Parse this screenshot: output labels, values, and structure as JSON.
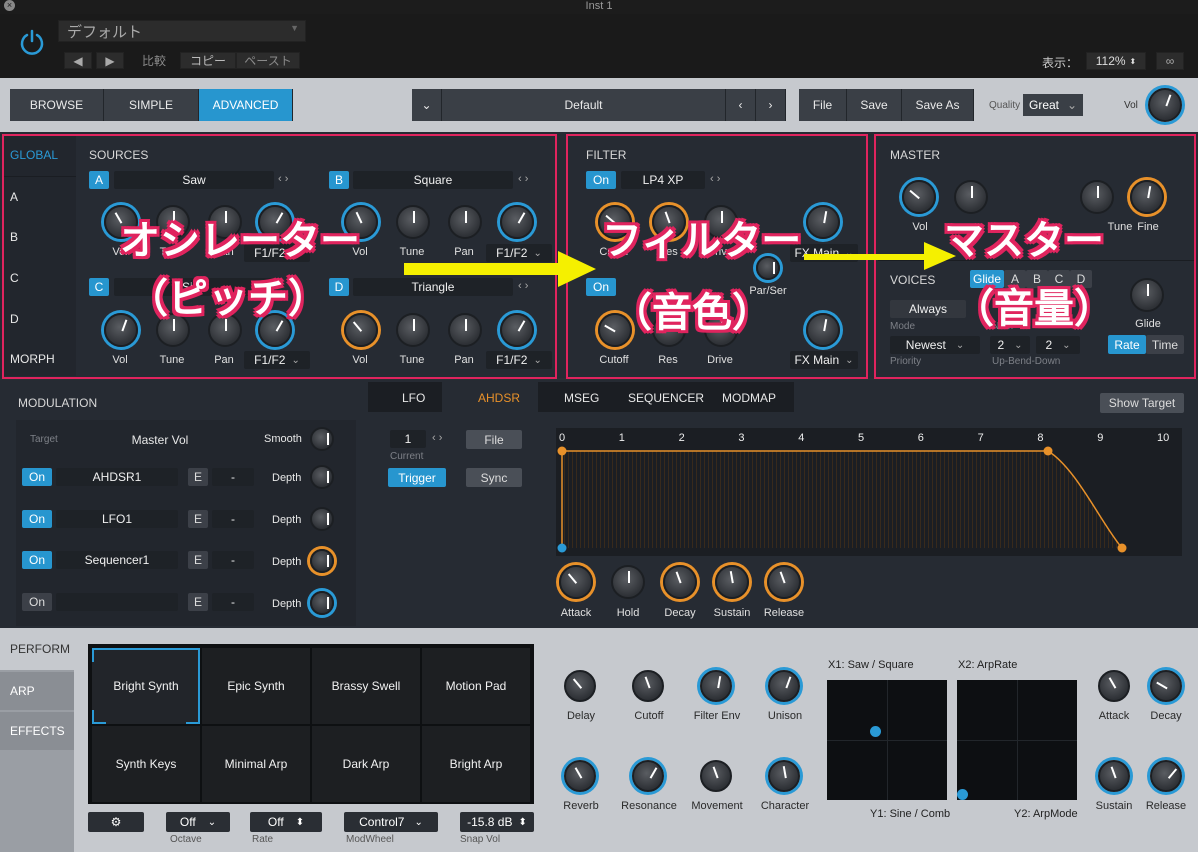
{
  "window": {
    "title": "Inst 1"
  },
  "plugin_header": {
    "preset": "デフォルト",
    "compare": "比較",
    "copy": "コピー",
    "paste": "ペースト",
    "view_label": "表示：",
    "zoom": "112%"
  },
  "toolbar": {
    "browse": "BROWSE",
    "simple": "SIMPLE",
    "advanced": "ADVANCED",
    "patch_name": "Default",
    "file": "File",
    "save": "Save",
    "save_as": "Save As",
    "quality_label": "Quality",
    "quality_value": "Great",
    "vol_label": "Vol"
  },
  "sidebar": {
    "items": [
      "GLOBAL",
      "A",
      "B",
      "C",
      "D",
      "MORPH"
    ]
  },
  "sources": {
    "title": "SOURCES",
    "oscA": {
      "letter": "A",
      "wave": "Saw",
      "knobs": [
        "Vol",
        "Tune",
        "Pan"
      ],
      "route": "F1/F2"
    },
    "oscB": {
      "letter": "B",
      "wave": "Square",
      "knobs": [
        "Vol",
        "Tune",
        "Pan"
      ],
      "route": "F1/F2"
    },
    "oscC": {
      "letter": "C",
      "wave": "Sine",
      "knobs": [
        "Vol",
        "Tune",
        "Pan"
      ],
      "route": "F1/F2"
    },
    "oscD": {
      "letter": "D",
      "wave": "Triangle",
      "knobs": [
        "Vol",
        "Tune",
        "Pan"
      ],
      "route": "F1/F2"
    }
  },
  "filter": {
    "title": "FILTER",
    "f1_on": "On",
    "f1_type": "LP4 XP",
    "f1_knobs": [
      "Cutoff",
      "Res",
      "Drive"
    ],
    "f1_route": "FX Main",
    "par_ser": "Par/Ser",
    "f2_on": "On",
    "f2_knobs": [
      "Cutoff",
      "Res",
      "Drive"
    ],
    "f2_route": "FX Main"
  },
  "master": {
    "title": "MASTER",
    "knobs": [
      "Vol",
      "Tune",
      "Fine"
    ],
    "voices_title": "VOICES",
    "voice_tabs": [
      "Glide",
      "A",
      "B",
      "C",
      "D"
    ],
    "mode_value": "Always",
    "mode_label": "Mode",
    "num_label": "Num",
    "priority_value": "Newest",
    "priority_label": "Priority",
    "bend_up": "2",
    "bend_down": "2",
    "bend_label": "Up-Bend-Down",
    "glide_label": "Glide",
    "rate": "Rate",
    "time": "Time"
  },
  "modulation": {
    "title": "MODULATION",
    "target_label": "Target",
    "target_value": "Master Vol",
    "smooth_label": "Smooth",
    "rows": [
      {
        "on": "On",
        "source": "AHDSR1",
        "e": "E",
        "via": "-",
        "depth": "Depth"
      },
      {
        "on": "On",
        "source": "LFO1",
        "e": "E",
        "via": "-",
        "depth": "Depth"
      },
      {
        "on": "On",
        "source": "Sequencer1",
        "e": "E",
        "via": "-",
        "depth": "Depth"
      },
      {
        "on": "On",
        "source": "",
        "e": "E",
        "via": "-",
        "depth": "Depth"
      }
    ]
  },
  "mod_tabs": [
    "LFO",
    "AHDSR",
    "MSEG",
    "SEQUENCER",
    "MODMAP"
  ],
  "show_target": "Show Target",
  "envelope": {
    "current_value": "1",
    "current_label": "Current",
    "file": "File",
    "trigger": "Trigger",
    "sync": "Sync",
    "ticks": [
      "0",
      "1",
      "2",
      "3",
      "4",
      "5",
      "6",
      "7",
      "8",
      "9",
      "10"
    ],
    "knobs": [
      "Attack",
      "Hold",
      "Decay",
      "Sustain",
      "Release"
    ]
  },
  "perform": {
    "tabs": [
      "PERFORM",
      "ARP",
      "EFFECTS"
    ],
    "pads": [
      "Bright Synth",
      "Epic Synth",
      "Brassy Swell",
      "Motion Pad",
      "Synth Keys",
      "Minimal Arp",
      "Dark Arp",
      "Bright Arp"
    ],
    "macro_knobs_row1": [
      "Delay",
      "Cutoff",
      "Filter Env",
      "Unison"
    ],
    "macro_knobs_row2": [
      "Reverb",
      "Resonance",
      "Movement",
      "Character"
    ],
    "xy1_top": "X1: Saw / Square",
    "xy1_bottom": "Y1: Sine / Comb",
    "xy2_top": "X2: ArpRate",
    "xy2_bottom": "Y2: ArpMode",
    "env_knobs_row1": [
      "Attack",
      "Decay"
    ],
    "env_knobs_row2": [
      "Sustain",
      "Release"
    ],
    "bottom": {
      "octave_value": "Off",
      "octave_label": "Octave",
      "rate_value": "Off",
      "rate_label": "Rate",
      "modwheel_value": "Control7",
      "modwheel_label": "ModWheel",
      "snapvol_value": "-15.8 dB",
      "snapvol_label": "Snap Vol"
    }
  },
  "annotations": {
    "osc": "オシレーター",
    "osc_sub": "（ピッチ）",
    "filter": "フィルター",
    "filter_sub": "（音色）",
    "master": "マスター",
    "master_sub": "（音量）"
  },
  "colors": {
    "accent": "#2796cf",
    "orange": "#e8912a",
    "annotation": "#e0245e",
    "arrow": "#f5f000"
  }
}
